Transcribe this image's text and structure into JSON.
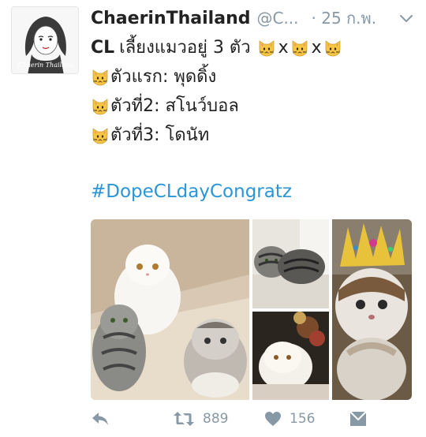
{
  "tweet": {
    "display_name": "ChaerinThailand",
    "handle": "@C...",
    "time": "25 ก.พ.",
    "avatar_text": "Chaerin Thailand",
    "line1_prefix": "CL",
    "line1_text": "เลี้ยงแมวอยู่ 3 ตัว",
    "separator": "x",
    "line2_text": "ตัวแรก: พุดดิ้ง",
    "line3_text": "ตัวที่2: สโนว์บอล",
    "line4_text": "ตัวที่3: โดนัท",
    "hashtag": "#DopeCLdayCongratz"
  },
  "actions": {
    "retweets": "889",
    "likes": "156"
  },
  "icons": {
    "reply": "reply-icon",
    "retweet": "retweet-icon",
    "like": "heart-icon",
    "dm": "direct-message-icon",
    "menu": "chevron-down-icon",
    "emoji": "cat-face-emoji"
  },
  "colors": {
    "link": "#2b95d6",
    "muted": "#8899a6",
    "emoji": "#f7c544"
  }
}
